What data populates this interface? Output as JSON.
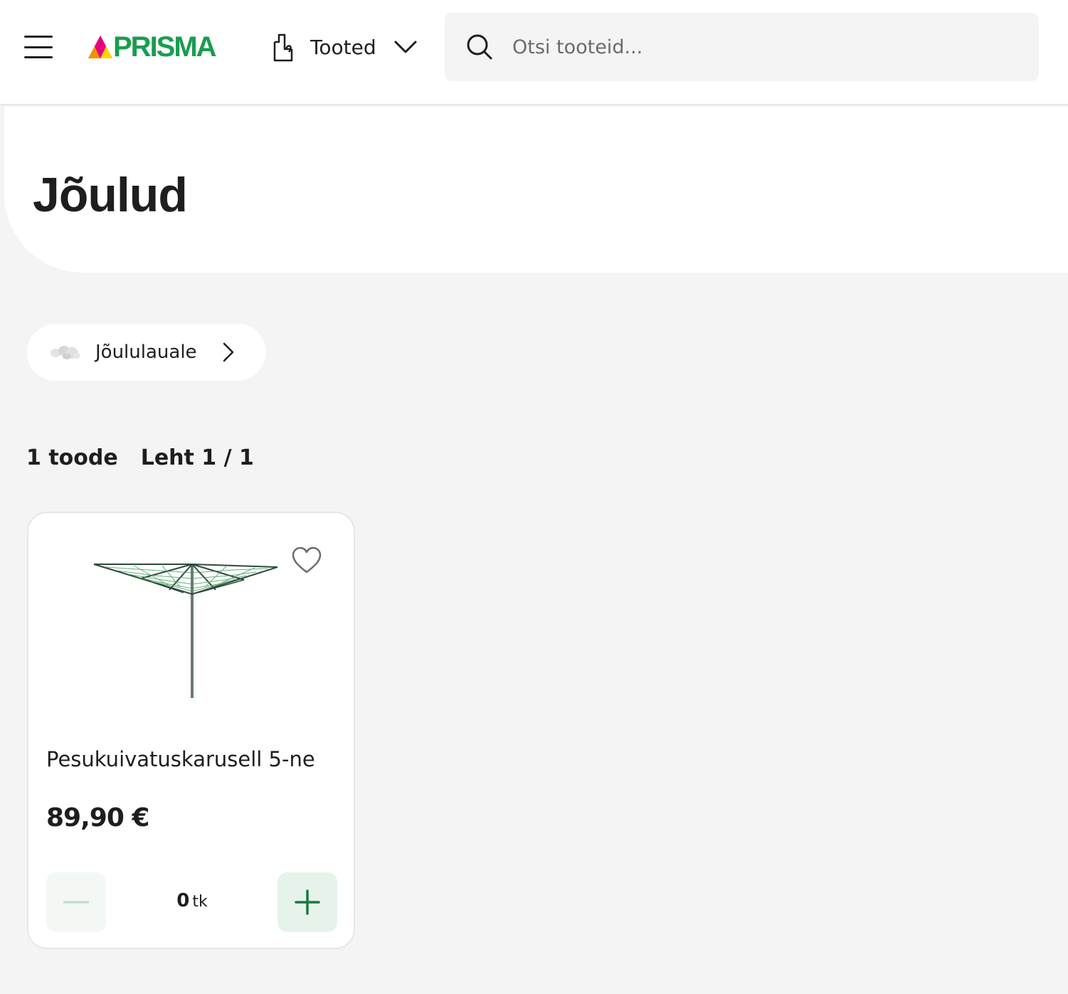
{
  "header": {
    "logo_text": "PRISMA",
    "products_label": "Tooted",
    "search_placeholder": "Otsi tooteid..."
  },
  "page": {
    "title": "Jõulud"
  },
  "subcategory": {
    "label": "Jõululauale"
  },
  "results": {
    "count": "1 toode",
    "page": "Leht 1 / 1"
  },
  "products": [
    {
      "name": "Pesukuivatuskarusell 5-ne",
      "price": "89,90 €",
      "quantity": "0",
      "unit": "tk"
    }
  ],
  "colors": {
    "brand_green": "#1a9c50",
    "background": "#f4f4f4",
    "plus_button_bg": "#e6f3ea",
    "plus_icon": "#1a7a42"
  },
  "icons": {
    "menu": "hamburger-icon",
    "products": "shopping-bag-icon",
    "dropdown": "chevron-down-icon",
    "search": "search-icon",
    "subcategory_arrow": "chevron-right-icon",
    "favorite": "heart-icon",
    "decrease": "minus-icon",
    "increase": "plus-icon"
  }
}
